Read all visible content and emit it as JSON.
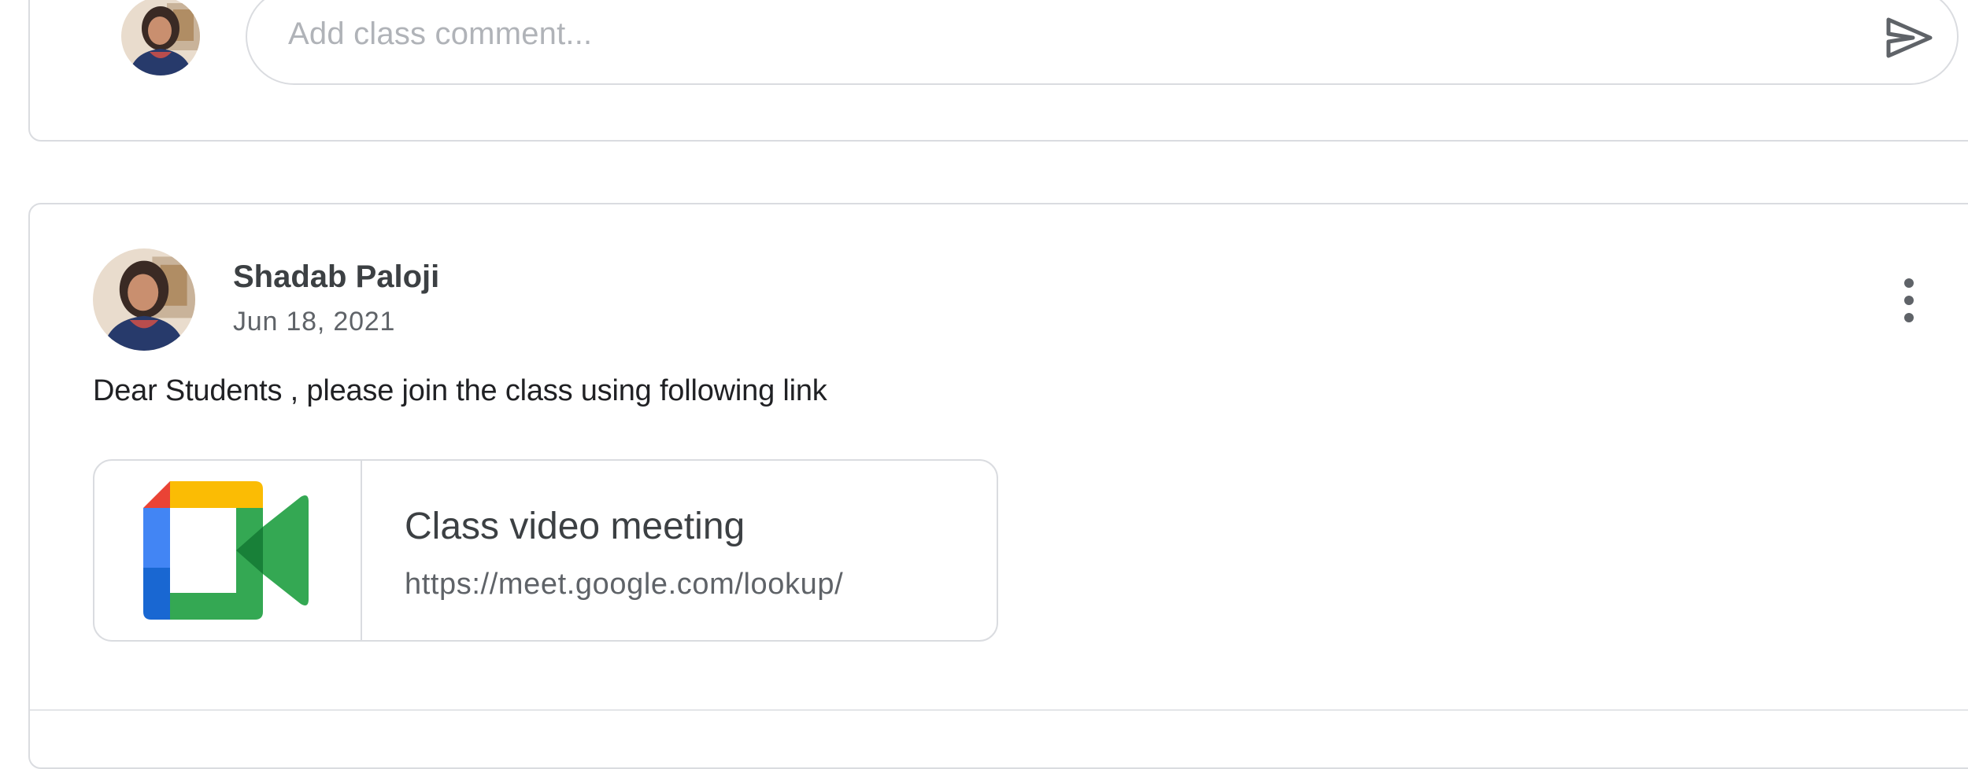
{
  "comment_box": {
    "placeholder": "Add class comment...",
    "avatar_icon": "user-avatar-photo",
    "send_icon": "send-icon"
  },
  "post": {
    "author": "Shadab Paloji",
    "date": "Jun 18, 2021",
    "text": "Dear Students , please join the class using following link",
    "more_icon": "more-vert-icon",
    "attachment": {
      "title": "Class video meeting",
      "url": "https://meet.google.com/lookup/",
      "icon": "google-meet-icon"
    }
  },
  "colors": {
    "border": "#dadce0",
    "text_primary": "#3c4043",
    "text_secondary": "#5f6368",
    "meet_blue": "#4285f4",
    "meet_red": "#ea4335",
    "meet_yellow": "#fbbc04",
    "meet_green": "#34a853"
  }
}
